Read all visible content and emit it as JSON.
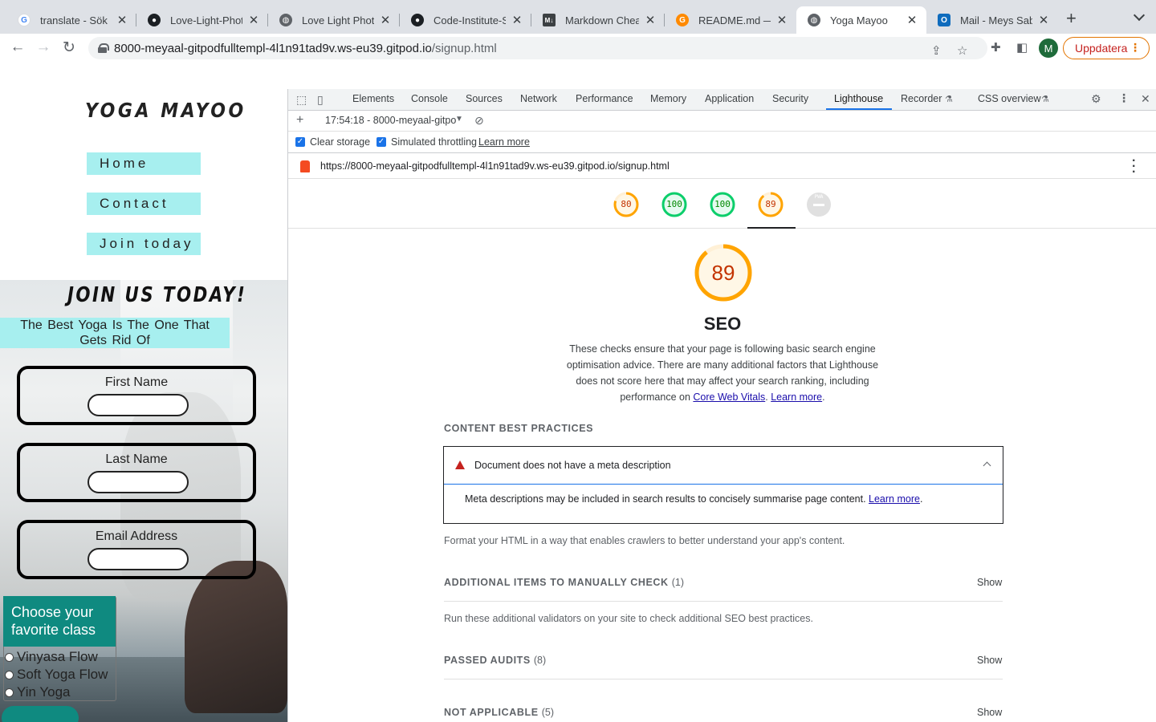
{
  "browser": {
    "tabs": [
      {
        "title": "translate - Sök på",
        "favicon": "google-icon",
        "active": false
      },
      {
        "title": "Love-Light-Photo",
        "favicon": "github-icon",
        "active": false
      },
      {
        "title": "Love Light Photog",
        "favicon": "globe-icon",
        "active": false
      },
      {
        "title": "Code-Institute-Sc",
        "favicon": "github-icon",
        "active": false
      },
      {
        "title": "Markdown Cheat",
        "favicon": "markdown-icon",
        "active": false
      },
      {
        "title": "README.md — gi",
        "favicon": "gitpod-icon",
        "active": false
      },
      {
        "title": "Yoga Mayoo",
        "favicon": "globe-icon",
        "active": true
      },
      {
        "title": "Mail - Meys Saba",
        "favicon": "outlook-icon",
        "active": false
      }
    ],
    "url_host": "8000-meyaal-gitpodfulltempl-4l1n91tad9v.ws-eu39.gitpod.io",
    "url_path": "/signup.html",
    "profile_initial": "M",
    "update_label": "Uppdatera"
  },
  "site": {
    "logo": "YOGA MAYOO",
    "nav": [
      "Home",
      "Contact",
      "Join today"
    ],
    "join_title": "JOIN US TODAY!",
    "tagline": "The Best Yoga Is The One That Gets Rid Of",
    "fields": [
      "First Name",
      "Last Name",
      "Email Address"
    ],
    "class_heading": "Choose your favorite class",
    "classes": [
      "Vinyasa Flow",
      "Soft Yoga Flow",
      "Yin Yoga"
    ]
  },
  "devtools": {
    "tabs": [
      "Elements",
      "Console",
      "Sources",
      "Network",
      "Performance",
      "Memory",
      "Application",
      "Security",
      "Lighthouse",
      "Recorder",
      "CSS overview"
    ],
    "active_tab": "Lighthouse",
    "report_select": "17:54:18 - 8000-meyaal-gitpo",
    "clear_storage": "Clear storage",
    "simulated_throttling": "Simulated throttling",
    "learn_more": "Learn more",
    "report_url": "https://8000-meyaal-gitpodfulltempl-4l1n91tad9v.ws-eu39.gitpod.io/signup.html",
    "scores": [
      {
        "value": 80,
        "color": "#ffa400",
        "text_color": "#c33300"
      },
      {
        "value": 100,
        "color": "#0cce6b",
        "text_color": "#008800"
      },
      {
        "value": 100,
        "color": "#0cce6b",
        "text_color": "#008800"
      },
      {
        "value": 89,
        "color": "#ffa400",
        "text_color": "#c33300"
      },
      {
        "value": null,
        "label": "PWA",
        "color": "#e0e0e0"
      }
    ],
    "seo": {
      "score": 89,
      "title": "SEO",
      "description_pre": "These checks ensure that your page is following basic search engine optimisation advice. There are many additional factors that Lighthouse does not score here that may affect your search ranking, including performance on ",
      "core_web_vitals": "Core Web Vitals",
      "period_space": ". ",
      "learn_more": "Learn more",
      "period": "."
    },
    "content_best_practices": "CONTENT BEST PRACTICES",
    "audit_title": "Document does not have a meta description",
    "audit_body": "Meta descriptions may be included in search results to concisely summarise page content. ",
    "audit_learn_more": "Learn more",
    "format_text": "Format your HTML in a way that enables crawlers to better understand your app's content.",
    "manual_check": "ADDITIONAL ITEMS TO MANUALLY CHECK",
    "manual_count": "(1)",
    "manual_text": "Run these additional validators on your site to check additional SEO best practices.",
    "passed": "PASSED AUDITS",
    "passed_count": "(8)",
    "not_applicable": "NOT APPLICABLE",
    "na_count": "(5)",
    "show": "Show"
  }
}
